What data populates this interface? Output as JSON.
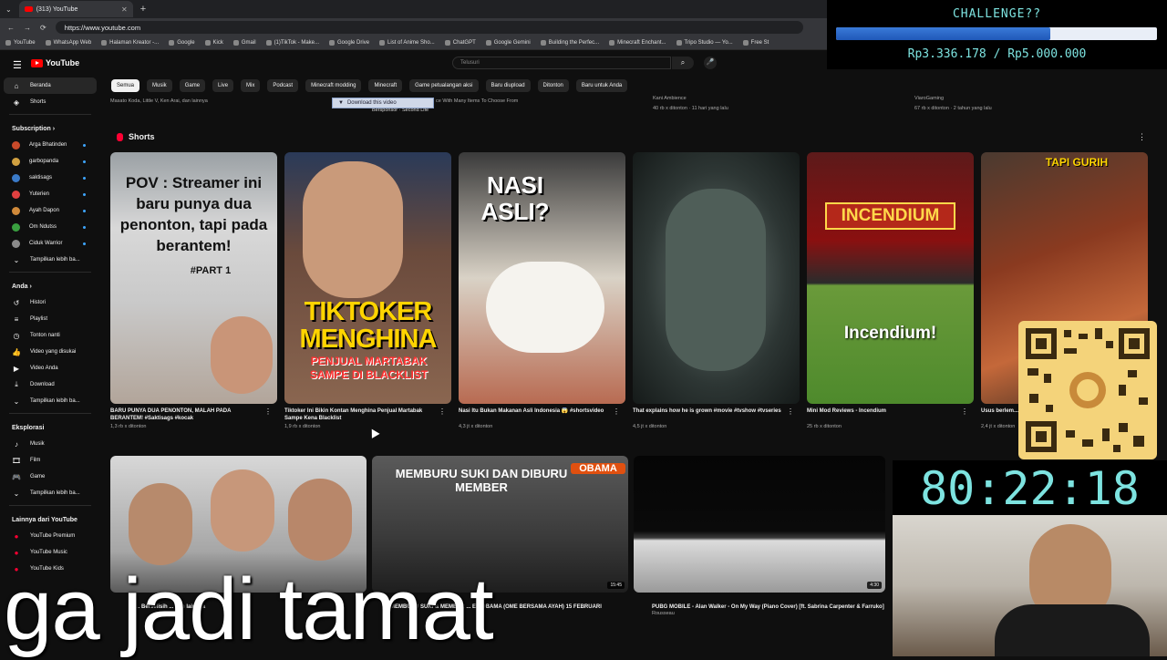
{
  "browser": {
    "tab_title": "(313) YouTube",
    "url": "https://www.youtube.com",
    "bookmarks": [
      "YouTube",
      "WhatsApp Web",
      "Halaman Kreator -...",
      "Google",
      "Kick",
      "Gmail",
      "(1)TikTok - Make...",
      "Google Drive",
      "List of Anime Sho...",
      "ChatGPT",
      "Google Gemini",
      "Building the Perfec...",
      "Minecraft Enchant...",
      "Tripo Studio — Yo...",
      "Free St"
    ]
  },
  "header": {
    "logo_text": "YouTube",
    "search_placeholder": "Telusuri"
  },
  "sidebar": {
    "home": "Beranda",
    "shorts": "Shorts",
    "subscription_title": "Subscription",
    "subscriptions": [
      {
        "name": "Arga Bhatinden",
        "color": "#c84a2a"
      },
      {
        "name": "garbopanda",
        "color": "#d0a040"
      },
      {
        "name": "saktisags",
        "color": "#3a7ac8"
      },
      {
        "name": "Yuterien",
        "color": "#e04040"
      },
      {
        "name": "Ayah Dapon",
        "color": "#d08a3a"
      },
      {
        "name": "Om Ndutss",
        "color": "#3aa040"
      },
      {
        "name": "Ciduk Warrior",
        "color": "#8a8a8a"
      }
    ],
    "show_more": "Tampilkan lebih ba...",
    "you_title": "Anda",
    "you_items": [
      "Histori",
      "Playlist",
      "Tonton nanti",
      "Video yang disukai",
      "Video Anda",
      "Download",
      "Tampilkan lebih ba..."
    ],
    "explore_title": "Eksplorasi",
    "explore_items": [
      "Musik",
      "Film",
      "Game",
      "Tampilkan lebih ba..."
    ],
    "more_title": "Lainnya dari YouTube",
    "more_items": [
      "YouTube Premium",
      "YouTube Music",
      "YouTube Kids"
    ]
  },
  "chips": [
    "Semua",
    "Musik",
    "Game",
    "Live",
    "Mix",
    "Podcast",
    "Minecraft modding",
    "Minecraft",
    "Game petualangan aksi",
    "Baru diupload",
    "Ditonton",
    "Baru untuk Anda"
  ],
  "prev_row": {
    "a": "Masato Koda, Little V, Ken Arai, dan lainnya",
    "b_chan": "Kani Ambience",
    "b_meta": "40 rb x ditonton · 11 hari yang lalu",
    "c_chan": "ViaroGaming",
    "c_meta": "67 rb x ditonton · 2 tahun yang lalu",
    "ad_label": "Bersponsor · Second Life",
    "ad_text": "ce With Many Items To Choose From"
  },
  "download_popup": "Download this video",
  "shorts_title": "Shorts",
  "shorts": [
    {
      "title": "BARU PUNYA DUA PENONTON, MALAH PADA BERANTEM! #Saktisags #kocak",
      "views": "1,3 rb x ditonton",
      "overlay": "POV : Streamer ini baru punya dua penonton, tapi pada berantem!",
      "tag": "#PART 1"
    },
    {
      "title": "Tiktoker Ini Bikin Kontan Menghina Penjual Martabak Sampe Kena Blacklist",
      "views": "1,9 rb x ditonton",
      "overlay": "TIKTOKER MENGHINA",
      "tag": "PENJUAL MARTABAK SAMPE DI BLACKLIST"
    },
    {
      "title": "Nasi Itu Bukan Makanan Asli Indonesia 😱 #shortsvideo",
      "views": "4,3 jt x ditonton",
      "overlay": "NASI ASLI?",
      "tag": ""
    },
    {
      "title": "That explains how he is grown #movie #tvshow #tvseries",
      "views": "4,5 jt x ditonton",
      "overlay": "",
      "tag": ""
    },
    {
      "title": "Mini Mod Reviews - Incendium",
      "views": "25 rb x ditonton",
      "overlay": "INCENDIUM",
      "tag": "Incendium!"
    },
    {
      "title": "Usus berlem... diminati",
      "views": "2,4 jt x ditonton",
      "overlay": "TAPI GURIH",
      "tag": ""
    }
  ],
  "videos": [
    {
      "title": "Pe... Berselisih ... dan lainnya",
      "channel": "",
      "duration": ""
    },
    {
      "title": "MEMBURU SUKI & MEMBER ... ER OBAMA (OME BERSAMA AYAH) 15 FEBRUARI",
      "channel": "",
      "duration": "15:45",
      "overlay": "MEMBURU SUKI DAN DIBURU MEMBER",
      "badge": "OBAMA"
    },
    {
      "title": "PUBG MOBILE - Alan Walker - On My Way (Piano Cover) [ft. Sabrina Carpenter & Farruko]",
      "channel": "Rousseau",
      "duration": "4:30"
    }
  ],
  "overlay": {
    "challenge_title": "CHALLENGE??",
    "progress": 0.667,
    "amount": "Rp3.336.178 / Rp5.000.000",
    "timer": "80:22:18",
    "subtitle": "ga jadi tamat"
  }
}
